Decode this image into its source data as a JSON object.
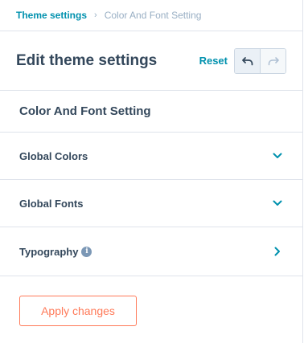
{
  "breadcrumb": {
    "parent": "Theme settings",
    "separator": "›",
    "current": "Color And Font Setting"
  },
  "header": {
    "title": "Edit theme settings",
    "reset_label": "Reset",
    "undo_icon": "undo-icon",
    "redo_icon": "redo-icon"
  },
  "section": {
    "title": "Color And Font Setting"
  },
  "rows": [
    {
      "label": "Global Colors",
      "icon": "chevron-down-icon"
    },
    {
      "label": "Global Fonts",
      "icon": "chevron-down-icon"
    },
    {
      "label": "Typography",
      "info_icon": "info-icon",
      "icon": "chevron-right-icon"
    }
  ],
  "footer": {
    "apply_label": "Apply changes"
  },
  "colors": {
    "link": "#0091ae",
    "text": "#33475b",
    "muted": "#99afc4",
    "border": "#dfe3eb",
    "accent": "#ff7a59"
  }
}
